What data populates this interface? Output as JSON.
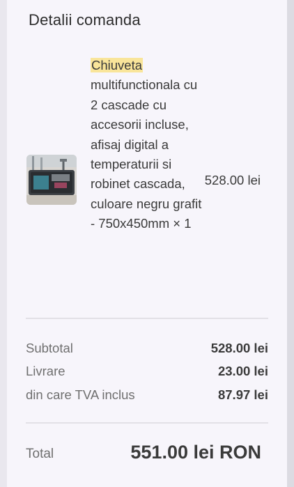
{
  "section_title": "Detalii comanda",
  "product": {
    "name_highlight": "Chiuveta",
    "name_rest": " multifunctionala cu 2 cascade cu accesorii incluse, afisaj digital a temperaturii si robinet cascada, culoare negru grafit - 750x450mm × 1",
    "price": "528.00 lei",
    "image_icon": "sink-product-thumbnail"
  },
  "summary": {
    "subtotal_label": "Subtotal",
    "subtotal_value": "528.00 lei",
    "shipping_label": "Livrare",
    "shipping_value": "23.00 lei",
    "vat_label": "din care TVA inclus",
    "vat_value": "87.97 lei"
  },
  "total": {
    "label": "Total",
    "value": "551.00 lei RON"
  },
  "colors": {
    "highlight": "#f9e59a",
    "panel_bg": "#f7f5fb",
    "divider": "#e2e0e6"
  }
}
